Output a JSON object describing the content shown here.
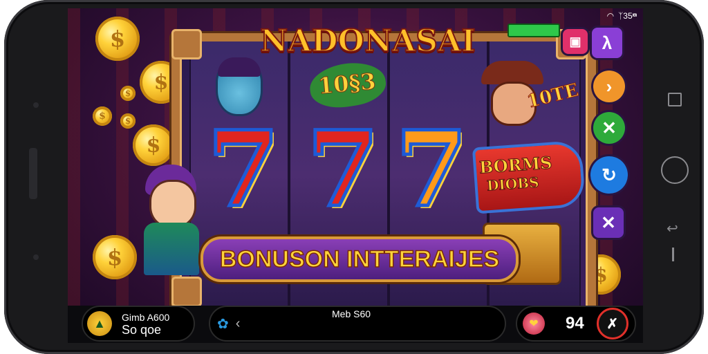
{
  "status_bar": {
    "text": "ᛉ35 ͫͦ"
  },
  "game": {
    "title": "NADONASAI",
    "jackpot_badge": "10§3",
    "reel_symbols": [
      "7",
      "7",
      "7"
    ],
    "bonus_sign": {
      "line1": "BORMS",
      "line2": "DIOBS"
    },
    "bonus_banner": "BONUSON INTTERAIJES",
    "side_sign": "10TE",
    "side_buttons": [
      {
        "icon": "lambda-icon",
        "glyph": "λ",
        "color": "#8a3fd6"
      },
      {
        "icon": "chevron-icon",
        "glyph": "›",
        "color": "#f0952a"
      },
      {
        "icon": "close-icon",
        "glyph": "✕",
        "color": "#2eaa3a"
      },
      {
        "icon": "refresh-icon",
        "glyph": "↻",
        "color": "#1e7be0"
      },
      {
        "icon": "cross-icon",
        "glyph": "✕",
        "color": "#6a2fb6"
      }
    ],
    "top_pink_button_glyph": "▣"
  },
  "bottom_bar": {
    "left_label_top": "Gimb A600",
    "left_label_bottom": "So qoe",
    "center_label": "Meb S60",
    "right_value": "94",
    "center_back_glyph": "‹",
    "gear_glyph": "✿"
  },
  "colors": {
    "accent_gold": "#ffc02a",
    "frame_wood": "#b5763a",
    "banner_purple": "#6a2fa0",
    "seven_red": "#e0251f",
    "seven_outline": "#1e5bd6"
  }
}
